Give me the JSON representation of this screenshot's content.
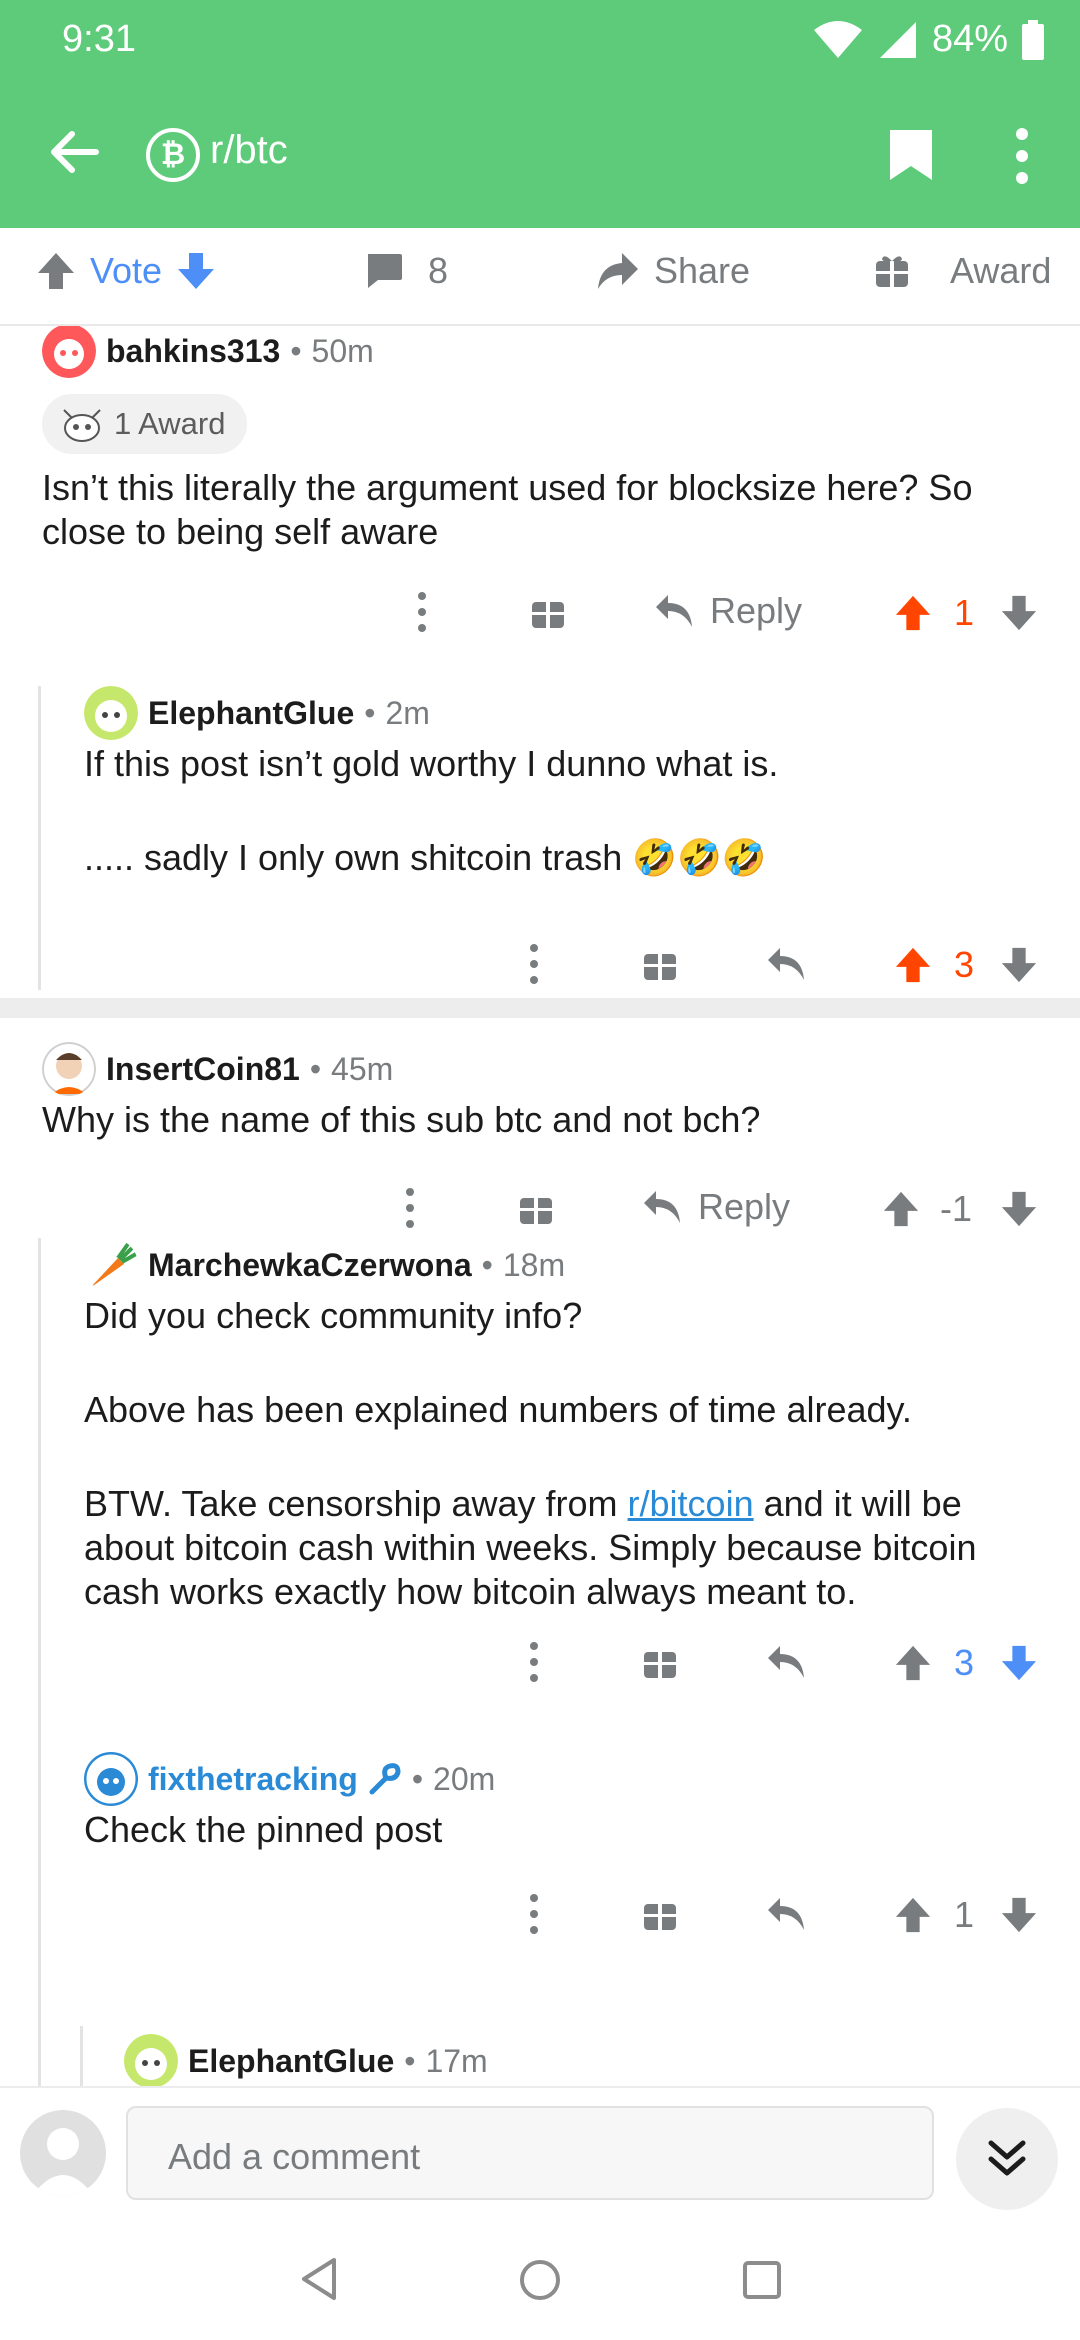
{
  "status_bar": {
    "time": "9:31",
    "battery": "84%"
  },
  "app_bar": {
    "subreddit": "r/btc",
    "sub_icon": "₿"
  },
  "post_actions": {
    "vote_label": "Vote",
    "comment_count": "8",
    "share_label": "Share",
    "award_label": "Award"
  },
  "comments": [
    {
      "user": "bahkins313",
      "time": "50m",
      "award_text": "1 Award",
      "text": "Isn’t this literally the argument used for blocksize here? So close to being self aware",
      "reply_label": "Reply",
      "score": "1"
    },
    {
      "user": "ElephantGlue",
      "time": "2m",
      "paragraph_1": "If this post isn’t gold worthy I dunno what is.",
      "paragraph_2": "..... sadly I only own shitcoin trash",
      "emoji": "🤣🤣🤣",
      "score": "3"
    },
    {
      "user": "InsertCoin81",
      "time": "45m",
      "text": "Why is the name of this sub btc and not bch?",
      "reply_label": "Reply",
      "score": "-1"
    },
    {
      "user": "MarchewkaCzerwona",
      "time": "18m",
      "paragraph_1": "Did you check community info?",
      "paragraph_2": "Above has been explained numbers of time already.",
      "paragraph_3_before": "BTW. Take censorship away from ",
      "paragraph_3_link": "r/bitcoin",
      "paragraph_3_after": " and it will be about bitcoin cash within weeks. Simply because bitcoin cash works exactly how bitcoin always meant to.",
      "score": "3"
    },
    {
      "user": "fixthetracking",
      "time": "20m",
      "text": "Check the pinned post",
      "score": "1"
    },
    {
      "user": "ElephantGlue",
      "time": "17m"
    }
  ],
  "composer": {
    "placeholder": "Add a comment"
  },
  "colors": {
    "header": "#5ecb7a",
    "upvote_active": "#ff4500",
    "downvote_active": "#4e8ef7",
    "username_mod": "#2a8ad6",
    "muted": "#787c7e"
  }
}
